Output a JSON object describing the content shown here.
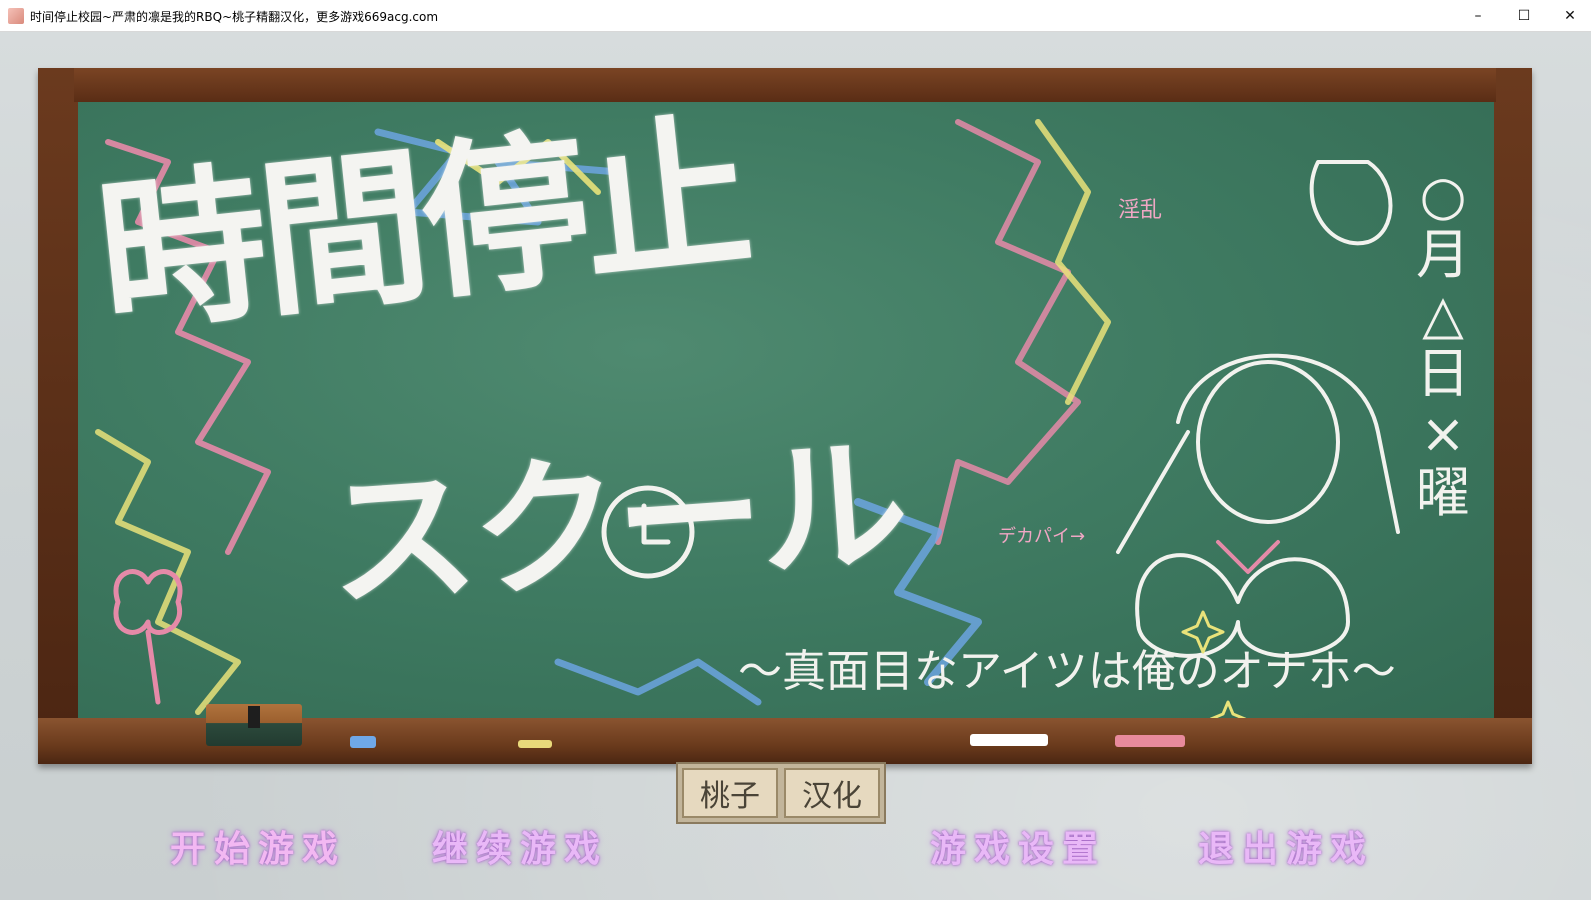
{
  "window": {
    "title": "时间停止校园~严肃的凛是我的RBQ~桃子精翻汉化，更多游戏669acg.com",
    "minimize": "–",
    "maximize": "☐",
    "close": "✕"
  },
  "board": {
    "title_line1": "時間停止",
    "title_line2": "スクール",
    "subtitle": "～真面目なアイツは俺のオナホ～",
    "date": "○月△日×曜",
    "note_1": "淫乱",
    "note_2": "デカパイ→"
  },
  "sign": {
    "tile_1": "桃子",
    "tile_2": "汉化"
  },
  "menu": {
    "start": "开始游戏",
    "continue": "继续游戏",
    "settings": "游戏设置",
    "exit": "退出游戏"
  },
  "colors": {
    "board": "#3f7b62",
    "frame": "#5a2d15",
    "menu_text": "#e9b8f7",
    "chalk_pink": "#e58aa8",
    "chalk_yellow": "#e9e27a",
    "chalk_blue": "#6fa8e8"
  }
}
